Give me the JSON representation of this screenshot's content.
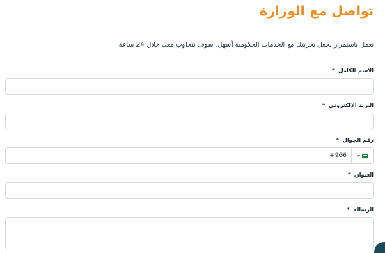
{
  "header": {
    "title": "تواصل مع الوزارة",
    "intro": "نعمل باستمرار لجعل تجربتك مع الخدمات الحكومية أسهل، سوف نتجاوب معك خلال 24 ساعة"
  },
  "form": {
    "required_marker": "*",
    "full_name": {
      "label": "الاسم الكامل",
      "value": ""
    },
    "email": {
      "label": "البريد الالكتروني",
      "value": ""
    },
    "mobile": {
      "label": "رقم الجوال",
      "dial_code": "+966",
      "country_flag": "saudi-flag-icon",
      "value": ""
    },
    "address": {
      "label": "العنوان",
      "value": ""
    },
    "message": {
      "label": "الرسالة",
      "value": ""
    }
  },
  "colors": {
    "title": "#e8902b",
    "border": "#d3d9de",
    "fab": "#1b4b5a"
  }
}
